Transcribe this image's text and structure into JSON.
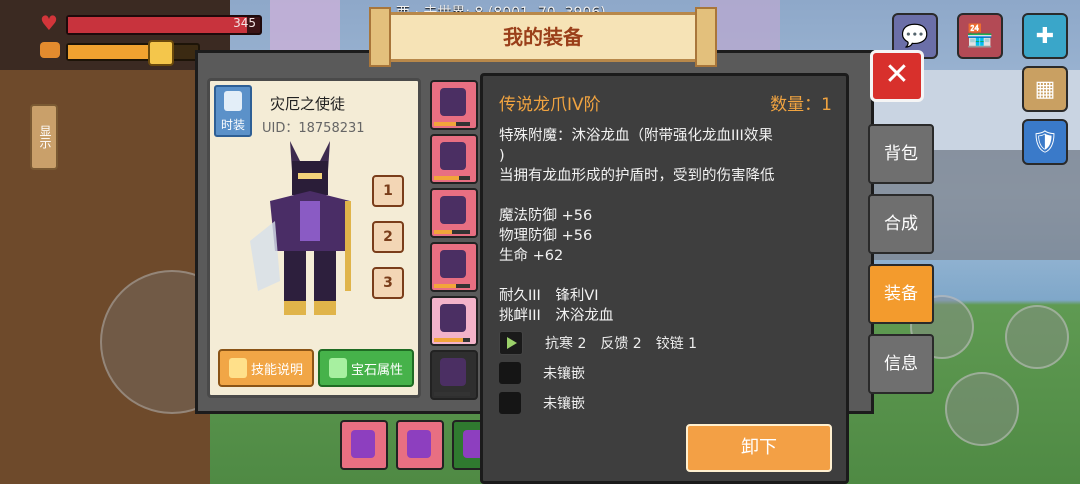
{
  "hud": {
    "hp_value": "345",
    "hp_fraction": 0.93,
    "food_fraction": 0.8,
    "world_label": "西 · 未世界: 8 (8001, 70, 3906)",
    "side_display_label": "显示"
  },
  "window": {
    "title": "我的装备",
    "close_icon": "close-icon"
  },
  "character": {
    "outfit_label": "时装",
    "name": "灾厄之使徒",
    "uid": "UID：18758231",
    "slots": [
      "1",
      "2",
      "3"
    ],
    "skill_button": "技能说明",
    "gem_button": "宝石属性"
  },
  "equipment_slots": [
    {
      "icon": "helmet-icon",
      "color": "#e86f82",
      "durability": 0.6
    },
    {
      "icon": "chestplate-icon",
      "color": "#e86f82",
      "durability": 0.7
    },
    {
      "icon": "leggings-icon",
      "color": "#e86f82",
      "durability": 0.5
    },
    {
      "icon": "boots-icon",
      "color": "#e86f82",
      "durability": 0.6
    },
    {
      "icon": "dragon-claw-icon",
      "color": "#f3b3c9",
      "durability": 0.8
    },
    {
      "icon": "ring-icon",
      "color": "#2f2f2f",
      "durability": 0.0
    }
  ],
  "bottom_slots": [
    {
      "icon": "scroll-icon",
      "color": "#e86f82"
    },
    {
      "icon": "sword-icon",
      "color": "#e86f82"
    },
    {
      "icon": "staff-icon",
      "color": "#2f7a2f"
    }
  ],
  "detail": {
    "item_name": "传说龙爪IV阶",
    "quantity": "数量：1",
    "lines": [
      "特殊附魔：沐浴龙血（附带强化龙血III效果",
      ")",
      "当拥有龙血形成的护盾时，受到的伤害降低",
      "",
      "魔法防御 +56",
      "物理防御 +56",
      "生命 +62",
      "",
      "耐久III　锋利VI",
      "挑衅III　沐浴龙血"
    ],
    "gem_rows": [
      {
        "filled": true,
        "text": "抗寒 2　反馈 2　铰链 1"
      },
      {
        "filled": false,
        "text": "未镶嵌"
      },
      {
        "filled": false,
        "text": "未镶嵌"
      }
    ],
    "unequip_button": "卸下"
  },
  "tabs": [
    {
      "label": "背包",
      "active": false
    },
    {
      "label": "合成",
      "active": false
    },
    {
      "label": "装备",
      "active": true
    },
    {
      "label": "信息",
      "active": false
    }
  ],
  "colors": {
    "accent_orange": "#f39b2d",
    "item_name": "#f0a340",
    "close_red": "#d8302c",
    "panel_bg": "#3e3e3e"
  }
}
